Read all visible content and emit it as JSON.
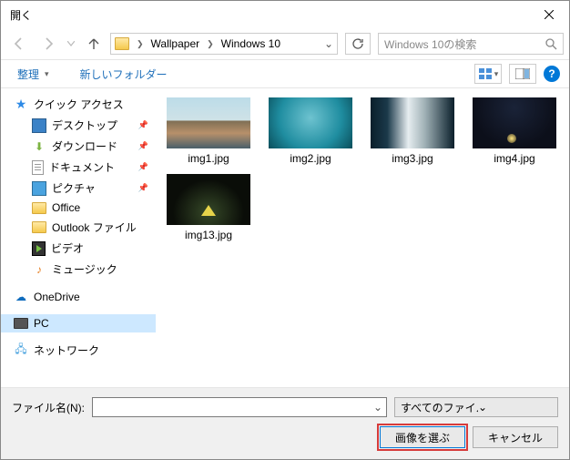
{
  "window": {
    "title": "開く"
  },
  "nav": {
    "path": [
      "Wallpaper",
      "Windows 10"
    ]
  },
  "search": {
    "placeholder": "Windows 10の検索"
  },
  "toolbar": {
    "organize": "整理",
    "newfolder": "新しいフォルダー"
  },
  "sidebar": {
    "quick_access": "クイック アクセス",
    "desktop": "デスクトップ",
    "downloads": "ダウンロード",
    "documents": "ドキュメント",
    "pictures": "ピクチャ",
    "office": "Office",
    "outlook": "Outlook ファイル",
    "videos": "ビデオ",
    "music": "ミュージック",
    "onedrive": "OneDrive",
    "pc": "PC",
    "network": "ネットワーク"
  },
  "files": {
    "items": [
      {
        "name": "img1.jpg"
      },
      {
        "name": "img2.jpg"
      },
      {
        "name": "img3.jpg"
      },
      {
        "name": "img4.jpg"
      },
      {
        "name": "img13.jpg"
      }
    ]
  },
  "footer": {
    "filename_label": "ファイル名(N):",
    "filename_value": "",
    "filter": "すべてのファイル (*.jpg;*.jpeg;*.bmp",
    "open": "画像を選ぶ",
    "cancel": "キャンセル"
  }
}
